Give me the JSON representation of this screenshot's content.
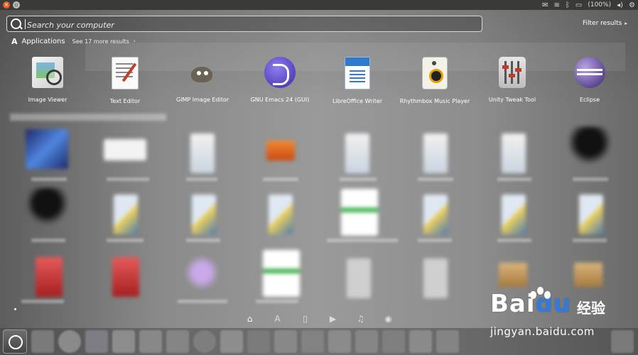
{
  "top_panel": {
    "battery": "(100%)",
    "colors": {
      "close": "#e45b2b",
      "panel": "#3a3a36"
    },
    "tray_icons": [
      "mail-icon",
      "wifi-icon",
      "bluetooth-icon",
      "battery-icon",
      "volume-icon",
      "gear-icon"
    ]
  },
  "search": {
    "placeholder": "Search your computer",
    "value": ""
  },
  "filter": {
    "label": "Filter results"
  },
  "category": {
    "title": "Applications",
    "more": "See 17 more results"
  },
  "apps": [
    {
      "label": "Image Viewer",
      "icon": "image-viewer-icon"
    },
    {
      "label": "Text Editor",
      "icon": "text-editor-icon"
    },
    {
      "label": "GIMP Image Editor",
      "icon": "gimp-icon"
    },
    {
      "label": "GNU Emacs 24 (GUI)",
      "icon": "emacs-icon"
    },
    {
      "label": "LibreOffice Writer",
      "icon": "libreoffice-writer-icon"
    },
    {
      "label": "Rhythmbox Music Player",
      "icon": "rhythmbox-icon"
    },
    {
      "label": "Unity Tweak Tool",
      "icon": "unity-tweak-icon"
    },
    {
      "label": "Eclipse",
      "icon": "eclipse-icon"
    }
  ],
  "lenses": [
    {
      "name": "home",
      "glyph": "⌂"
    },
    {
      "name": "applications",
      "glyph": "A"
    },
    {
      "name": "files",
      "glyph": "▯"
    },
    {
      "name": "video",
      "glyph": "▶"
    },
    {
      "name": "music",
      "glyph": "♫"
    },
    {
      "name": "photos",
      "glyph": "◉"
    }
  ],
  "watermark": {
    "logo_left": "Bai",
    "logo_right": "du",
    "chinese": "经验",
    "url": "jingyan.baidu.com"
  }
}
